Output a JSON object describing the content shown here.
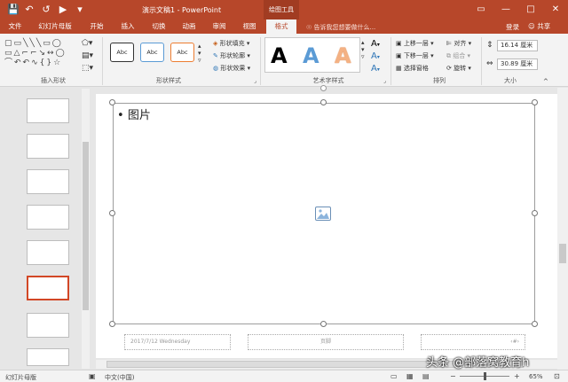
{
  "titlebar": {
    "title": "演示文稿1 - PowerPoint",
    "tools_label": "绘图工具",
    "qat_icons": [
      "save-icon",
      "undo-icon",
      "redo-icon",
      "present-icon",
      "customize-icon"
    ]
  },
  "tabs": [
    {
      "label": "文件"
    },
    {
      "label": "幻灯片母版"
    },
    {
      "label": "开始"
    },
    {
      "label": "插入"
    },
    {
      "label": "切换"
    },
    {
      "label": "动画"
    },
    {
      "label": "审阅"
    },
    {
      "label": "视图"
    },
    {
      "label": "格式",
      "active": true
    }
  ],
  "tell_me": "告诉我您想要做什么...",
  "account": {
    "login": "登录",
    "share": "共享"
  },
  "ribbon": {
    "groups": {
      "insert_shapes": "插入形状",
      "shape_styles": "形状样式",
      "wordart_styles": "艺术字样式",
      "arrange": "排列",
      "size": "大小"
    },
    "style_boxes": [
      "Abc",
      "Abc",
      "Abc"
    ],
    "shape_fill": "形状填充",
    "shape_outline": "形状轮廓",
    "shape_effects": "形状效果",
    "wordart_letters": [
      "A",
      "A",
      "A"
    ],
    "bring_forward": "上移一层",
    "send_backward": "下移一层",
    "selection_pane": "选择窗格",
    "align": "对齐",
    "group": "组合",
    "rotate": "旋转",
    "height": "16.14 厘米",
    "width": "30.89 厘米"
  },
  "slide": {
    "bullet_text": "图片",
    "footer_date": "2017/7/12 Wednesday",
    "footer_center": "页脚",
    "footer_number": "‹#›"
  },
  "status": {
    "view": "幻灯片母版",
    "language": "中文(中国)",
    "zoom": "65%"
  },
  "watermark": "头条 @部落窝教育h",
  "colors": {
    "accent": "#b7472a",
    "selection": "#d24726"
  }
}
